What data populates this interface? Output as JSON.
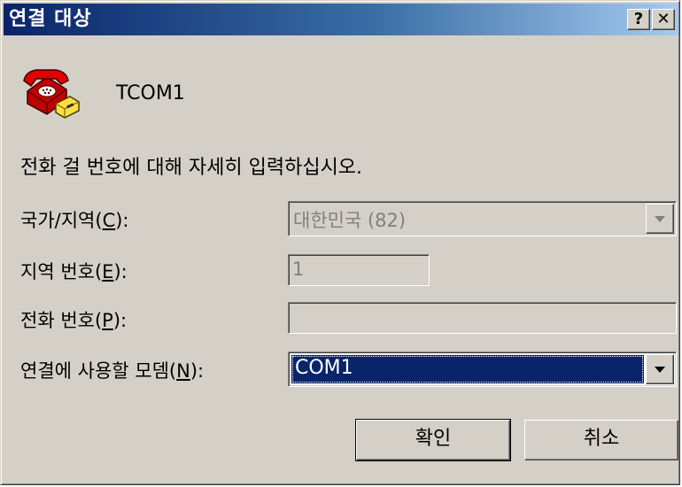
{
  "window": {
    "title": "연결 대상",
    "help_label": "?",
    "close_label": "✕"
  },
  "connection": {
    "icon": "telephone-icon",
    "name": "TCOM1"
  },
  "instructions": "전화 걸 번호에 대해 자세히 입력하십시오.",
  "fields": {
    "country": {
      "label_pre": "국가/지역(",
      "label_key": "C",
      "label_post": "):",
      "value": "대한민국 (82)",
      "enabled": false
    },
    "area_code": {
      "label_pre": "지역 번호(",
      "label_key": "E",
      "label_post": "):",
      "value": "1",
      "enabled": false
    },
    "phone_number": {
      "label_pre": "전화 번호(",
      "label_key": "P",
      "label_post": "):",
      "value": ""
    },
    "modem": {
      "label_pre": "연결에 사용할 모뎀(",
      "label_key": "N",
      "label_post": "):",
      "value": "COM1"
    }
  },
  "buttons": {
    "ok": "확인",
    "cancel": "취소"
  },
  "colors": {
    "title_gradient_start": "#0a246a",
    "title_gradient_end": "#a6caf0",
    "dialog_face": "#d4d0c8",
    "selection": "#0a246a"
  }
}
